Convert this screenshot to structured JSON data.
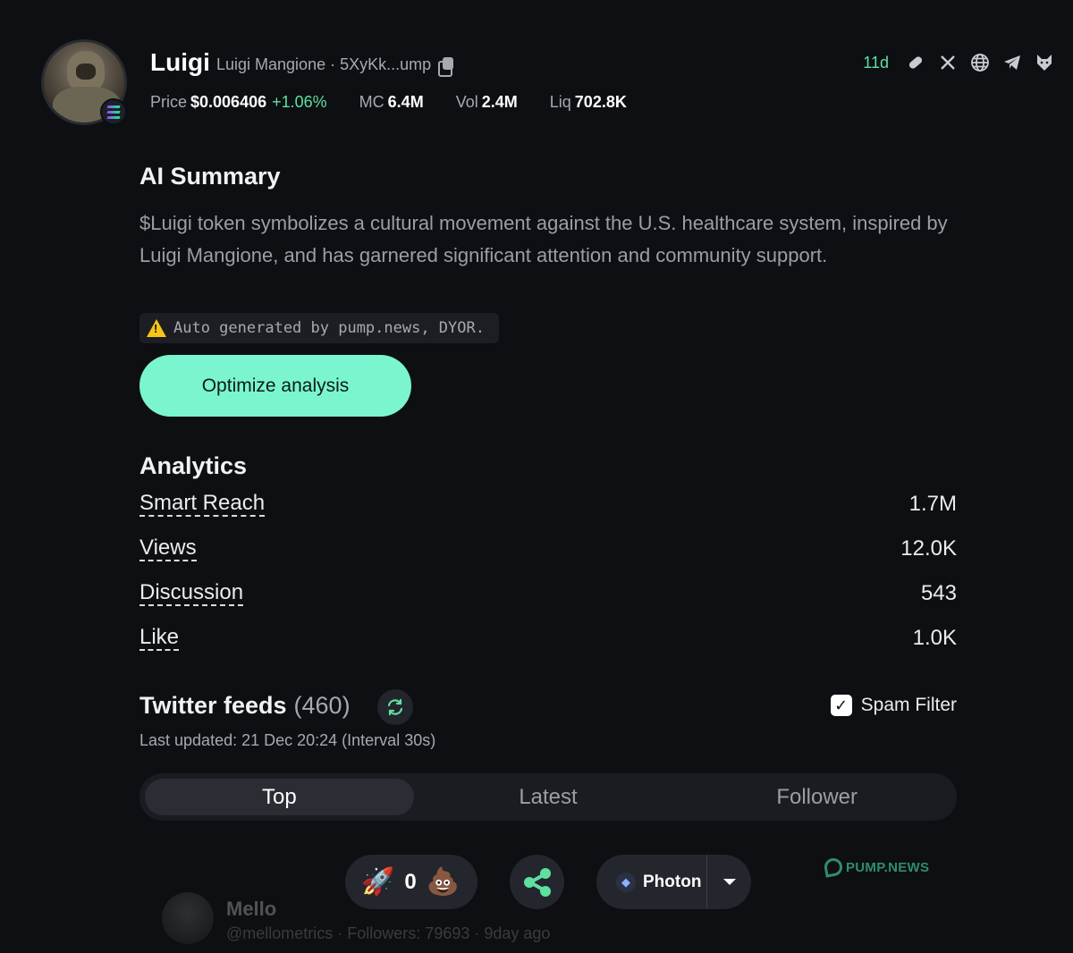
{
  "token": {
    "symbol": "Luigi",
    "subtitle": "Luigi Mangione · 5XyKk...ump",
    "age": "11d",
    "price_label": "Price",
    "price_value": "$0.006406",
    "price_change": "+1.06%",
    "mc_label": "MC",
    "mc_value": "6.4M",
    "vol_label": "Vol",
    "vol_value": "2.4M",
    "liq_label": "Liq",
    "liq_value": "702.8K"
  },
  "ai_summary": {
    "title": "AI Summary",
    "text": "$Luigi token symbolizes a cultural movement against the U.S. healthcare system, inspired by Luigi Mangione, and has garnered significant attention and community support.",
    "disclaimer": "Auto generated by pump.news, DYOR.",
    "button_label": "Optimize analysis"
  },
  "analytics": {
    "title": "Analytics",
    "metrics": [
      {
        "label": "Smart Reach",
        "value": "1.7M"
      },
      {
        "label": "Views",
        "value": "12.0K"
      },
      {
        "label": "Discussion",
        "value": "543"
      },
      {
        "label": "Like",
        "value": "1.0K"
      }
    ]
  },
  "twitter_feeds": {
    "title": "Twitter feeds",
    "count": "(460)",
    "spam_filter_label": "Spam Filter",
    "spam_filter_checked": true,
    "last_updated": "Last updated: 21 Dec 20:24 (Interval 30s)",
    "tabs": [
      "Top",
      "Latest",
      "Follower"
    ],
    "active_tab": "Top"
  },
  "feed_preview": {
    "name": "Mello",
    "meta": "@mellometrics · Followers: 79693 · 9day ago"
  },
  "action_bar": {
    "vote_count": "0",
    "photon_label": "Photon"
  },
  "watermark": "PUMP.NEWS",
  "colors": {
    "background": "#0d0f13",
    "accent": "#7af5cf",
    "positive": "#5ee0a0"
  },
  "icons": [
    "copy-icon",
    "pill-icon",
    "x-icon",
    "globe-icon",
    "telegram-icon",
    "wolf-icon",
    "warning-icon",
    "refresh-icon",
    "rocket-icon",
    "poop-icon",
    "share-icon",
    "photon-icon",
    "chevron-down-icon"
  ]
}
